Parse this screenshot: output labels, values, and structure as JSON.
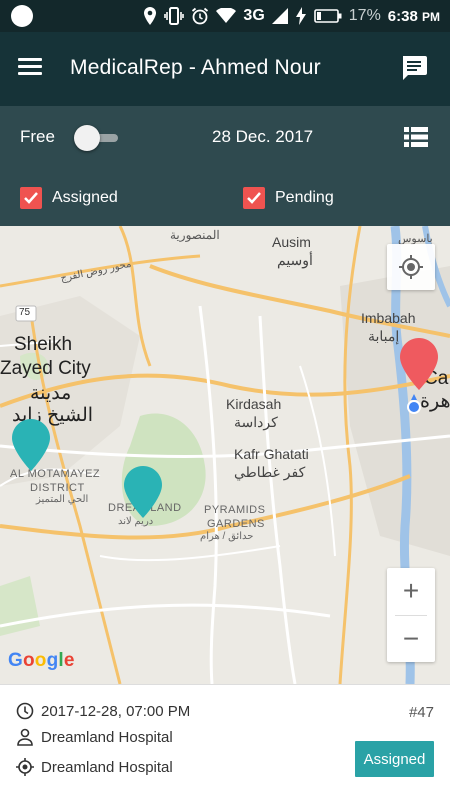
{
  "status_bar": {
    "network": "3G",
    "battery": "17%",
    "time": "6:38",
    "time_suffix": "PM"
  },
  "app_bar": {
    "title": "MedicalRep - Ahmed Nour",
    "menu_icon": "hamburger-menu-icon",
    "chat_icon": "chat-icon"
  },
  "filters": {
    "free_label": "Free",
    "free_enabled": false,
    "date": "28 Dec. 2017",
    "assigned": {
      "label": "Assigned",
      "checked": true
    },
    "pending": {
      "label": "Pending",
      "checked": true
    },
    "accent_color": "#ef5350"
  },
  "map": {
    "labels": {
      "mansoureya": "المنصورية",
      "ausim_en": "Ausim",
      "ausim_ar": "أوسيم",
      "road_75": "75",
      "road_faraj": "محور روض الفرج",
      "imbabah_en": "Imbabah",
      "imbabah_ar": "إمبابة",
      "bashteel": "باسوس",
      "sheikh_zayed_1": "Sheikh",
      "sheikh_zayed_2": "Zayed City",
      "sheikh_zayed_ar1": "مدينة",
      "sheikh_zayed_ar2": "الشيخ زايد",
      "kirdasah_en": "Kirdasah",
      "kirdasah_ar": "كرداسة",
      "kafr_en": "Kafr Ghatati",
      "kafr_ar": "كفر غطاطي",
      "motamayez_1": "AL MOTAMAYEZ",
      "motamayez_2": "DISTRICT",
      "motamayez_ar": "الحي المتميز",
      "dreamland_en": "DREAMLAND",
      "dreamland_ar": "دريم لاند",
      "pyramids_1": "PYRAMIDS",
      "pyramids_2": "GARDENS",
      "pyramids_ar": "حدائق / هرام",
      "cairo_partial": "Ca",
      "cairo_ar_partial": "هرة"
    },
    "google": [
      "G",
      "o",
      "o",
      "g",
      "l",
      "e"
    ],
    "zoom_in": "+",
    "zoom_out": "−",
    "marker_colors": {
      "assigned": "#2ab3b5",
      "pending": "#ef5a5f"
    }
  },
  "visit_card": {
    "datetime": "2017-12-28, 07:00 PM",
    "ticket": "#47",
    "doctor": "Dreamland Hospital",
    "place": "Dreamland Hospital",
    "status": "Assigned",
    "status_color": "#2aa2a6"
  }
}
